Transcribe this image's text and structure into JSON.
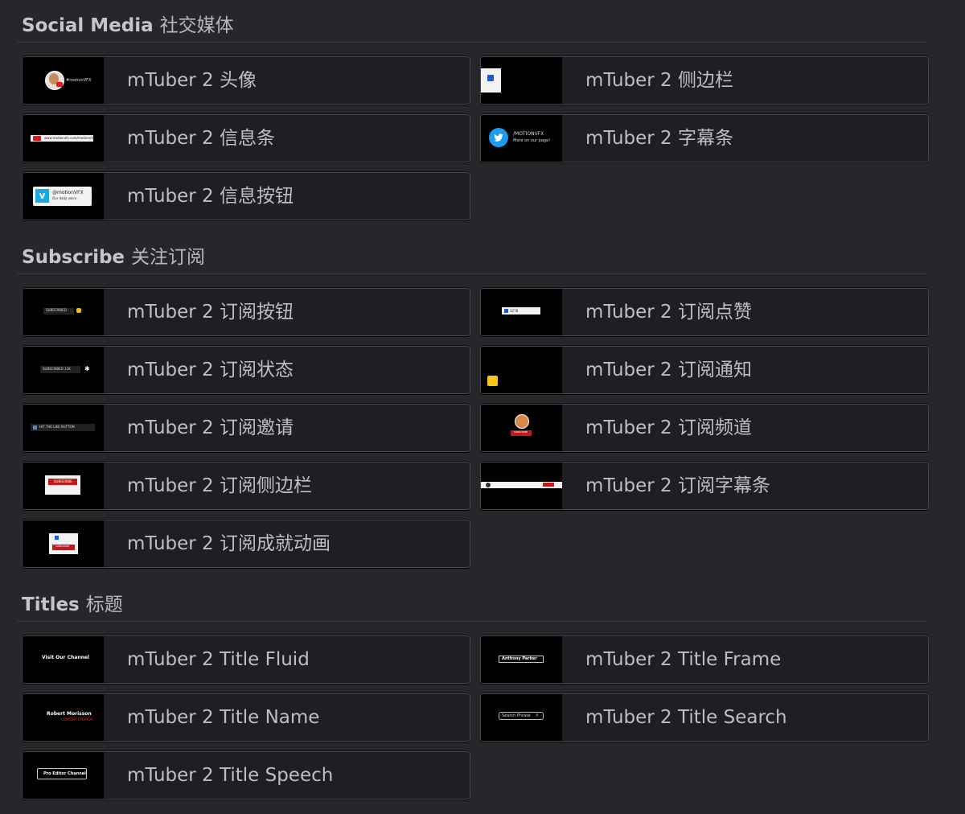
{
  "sections": [
    {
      "title": "Social Media",
      "title_cn": "社交媒体",
      "items": [
        {
          "label": "mTuber 2 头像",
          "thumb": "avatar-thumb",
          "thumb_text": "#motionVFX"
        },
        {
          "label": "mTuber 2 侧边栏",
          "thumb": "sidebar-thumb",
          "thumb_text": ""
        },
        {
          "label": "mTuber 2 信息条",
          "thumb": "infobar-thumb",
          "thumb_text": "www.motionvfx.com/motionvfx"
        },
        {
          "label": "mTuber 2 字幕条",
          "thumb": "twitter-thumb",
          "thumb_text": "/MOTIONVFX",
          "thumb_text2": "More on our page!"
        },
        {
          "label": "mTuber 2 信息按钮",
          "thumb": "vimeo-thumb",
          "thumb_text": "@motionVFX",
          "thumb_text2": "Our daily voice"
        }
      ]
    },
    {
      "title": "Subscribe",
      "title_cn": "关注订阅",
      "items": [
        {
          "label": "mTuber 2 订阅按钮",
          "thumb": "subscribed-thumb",
          "thumb_text": "SUBSCRIBED"
        },
        {
          "label": "mTuber 2 订阅点赞",
          "thumb": "like-thumb",
          "thumb_text": "3278"
        },
        {
          "label": "mTuber 2 订阅状态",
          "thumb": "subscribed-count-thumb",
          "thumb_text": "SUBSCRIBED 11K"
        },
        {
          "label": "mTuber 2 订阅通知",
          "thumb": "bell-thumb",
          "thumb_text": ""
        },
        {
          "label": "mTuber 2 订阅邀请",
          "thumb": "hit-like-thumb",
          "thumb_text": "HIT THE LIKE BUTTON"
        },
        {
          "label": "mTuber 2 订阅频道",
          "thumb": "channel-thumb",
          "thumb_text": "SUBSCRIBE"
        },
        {
          "label": "mTuber 2 订阅侧边栏",
          "thumb": "sidebar-subscribe-thumb",
          "thumb_text": "SUBSCRIBE"
        },
        {
          "label": "mTuber 2 订阅字幕条",
          "thumb": "lowerthird-subscribe-thumb",
          "thumb_text": ""
        },
        {
          "label": "mTuber 2 订阅成就动画",
          "thumb": "achievement-thumb",
          "thumb_text": "SUBSCRIBE"
        }
      ]
    },
    {
      "title": "Titles",
      "title_cn": "标题",
      "items": [
        {
          "label": "mTuber 2 Title Fluid",
          "thumb": "title-fluid-thumb",
          "thumb_text": "Visit Our Channel"
        },
        {
          "label": "mTuber 2 Title Frame",
          "thumb": "title-frame-thumb",
          "thumb_text": "Anthony Parker"
        },
        {
          "label": "mTuber 2 Title Name",
          "thumb": "title-name-thumb",
          "thumb_text": "Robert Morisson",
          "thumb_text2": "CONTENT CREATOR"
        },
        {
          "label": "mTuber 2 Title Search",
          "thumb": "title-search-thumb",
          "thumb_text": "Search Phrase"
        },
        {
          "label": "mTuber 2 Title Speech",
          "thumb": "title-speech-thumb",
          "thumb_text": "Pro Editor Channel"
        }
      ]
    }
  ]
}
